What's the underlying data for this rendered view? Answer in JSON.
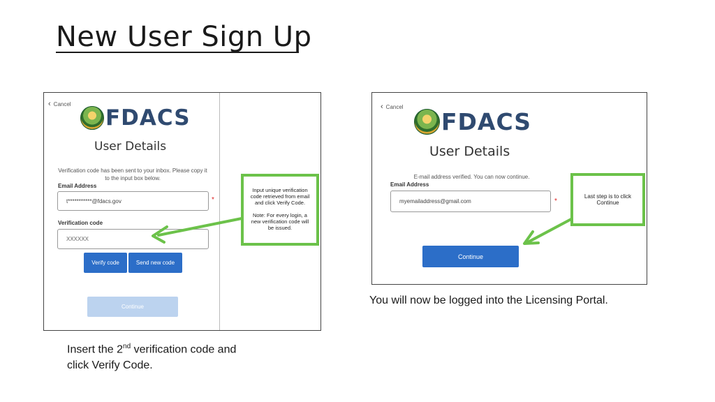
{
  "slide": {
    "title": "New User Sign Up",
    "caption_left_pre": "Insert the 2",
    "caption_left_sup": "nd",
    "caption_left_post": " verification code and",
    "caption_left_line2": "click Verify Code.",
    "caption_right": "You will now be logged into the Licensing Portal."
  },
  "left_screen": {
    "cancel_label": "Cancel",
    "logo_text": "FDACS",
    "heading": "User Details",
    "message_line1": "Verification code has been sent to your inbox. Please copy it",
    "message_line2": "to the input box below.",
    "email_label": "Email Address",
    "email_value": "t***********@fdacs.gov",
    "required_mark": "*",
    "code_label": "Verification code",
    "code_value": "XXXXXX",
    "verify_button": "Verify code",
    "send_new_button": "Send new code",
    "continue_button": "Continue",
    "callout_line1": "Input unique verification",
    "callout_line2": "code retrieved from email",
    "callout_line3": "and click Verify Code.",
    "callout_note1": "Note: For every login, a",
    "callout_note2": "new verification code will",
    "callout_note3": "be issued."
  },
  "right_screen": {
    "cancel_label": "Cancel",
    "logo_text": "FDACS",
    "heading": "User Details",
    "message": "E-mail address verified. You can now continue.",
    "email_label": "Email Address",
    "email_value": "myemailaddress@gmail.com",
    "required_mark": "*",
    "continue_button": "Continue",
    "callout_line1": "Last step is to click",
    "callout_line2": "Continue"
  },
  "icons": [
    "chevron-left-icon",
    "fdacs-seal-icon",
    "arrow-icon"
  ],
  "colors": {
    "callout_green": "#6cc24a",
    "button_blue": "#2c6ec8",
    "logo_navy": "#2f4a70",
    "required_red": "#d22222"
  }
}
